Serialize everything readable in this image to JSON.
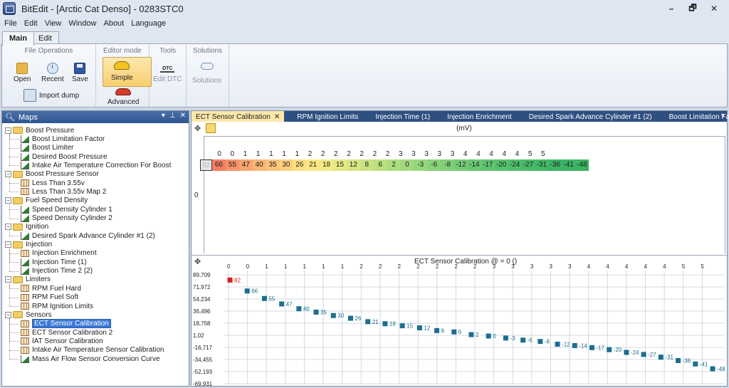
{
  "window": {
    "title": "BitEdit - [Arctic Cat Denso] - 0283STC0",
    "controls": [
      "–",
      "🗗",
      "✕"
    ]
  },
  "menu": [
    "File",
    "Edit",
    "View",
    "Window",
    "About",
    "Language"
  ],
  "ribbon": {
    "tabs": [
      "Main",
      "Edit"
    ],
    "groups": {
      "file_operations": {
        "title": "File Operations",
        "open": "Open",
        "recent": "Recent",
        "save": "Save",
        "import_dump": "Import dump"
      },
      "editor_mode": {
        "title": "Editor mode",
        "simple": "Simple",
        "advanced": "Advanced"
      },
      "tools": {
        "title": "Tools",
        "edit_dtc": "Edit DTC",
        "dtc_icon_text": "DTC"
      },
      "solutions": {
        "title": "Solutions",
        "solutions": "Solutions"
      }
    }
  },
  "maps_panel": {
    "title": "Maps",
    "header_buttons": [
      "▾",
      "⊥",
      "✕"
    ],
    "tree": [
      {
        "label": "Boost Pressure",
        "type": "folder"
      },
      {
        "label": "Boost Limitation Factor",
        "type": "curve"
      },
      {
        "label": "Boost Limiter",
        "type": "curve"
      },
      {
        "label": "Desired Boost Pressure",
        "type": "curve"
      },
      {
        "label": "Intake Air Temperature Correction For Boost",
        "type": "curve"
      },
      {
        "label": "Boost Pressure Sensor",
        "type": "folder"
      },
      {
        "label": "Less Than 3.55v",
        "type": "grid"
      },
      {
        "label": "Less Than 3.55v Map 2",
        "type": "grid"
      },
      {
        "label": "Fuel Speed Density",
        "type": "folder"
      },
      {
        "label": "Speed Density Cylinder 1",
        "type": "curve"
      },
      {
        "label": "Speed Density Cylinder 2",
        "type": "curve"
      },
      {
        "label": "Ignition",
        "type": "folder"
      },
      {
        "label": "Desired Spark Advance Cylinder #1 (2)",
        "type": "curve"
      },
      {
        "label": "Injection",
        "type": "folder"
      },
      {
        "label": "Injection Enrichment",
        "type": "grid"
      },
      {
        "label": "Injection Time (1)",
        "type": "curve"
      },
      {
        "label": "Injection Time 2 (2)",
        "type": "curve"
      },
      {
        "label": "Limiters",
        "type": "folder"
      },
      {
        "label": "RPM Fuel Hard",
        "type": "grid"
      },
      {
        "label": "RPM Fuel Soft",
        "type": "grid"
      },
      {
        "label": "RPM Ignition Limits",
        "type": "grid"
      },
      {
        "label": "Sensors",
        "type": "folder"
      },
      {
        "label": "ECT Sensor Calibration",
        "type": "grid",
        "selected": true
      },
      {
        "label": "ECT Sensor Calibration 2",
        "type": "grid"
      },
      {
        "label": "IAT Sensor Calibration",
        "type": "grid"
      },
      {
        "label": "Intake Air Temperature Sensor Calibration",
        "type": "grid"
      },
      {
        "label": "Mass Air Flow Sensor Conversion Curve",
        "type": "curve"
      }
    ]
  },
  "doc_tabs": [
    {
      "label": "ECT Sensor Calibration",
      "active": true
    },
    {
      "label": "RPM Ignition Limits"
    },
    {
      "label": "Injection Time (1)"
    },
    {
      "label": "Injection Enrichment"
    },
    {
      "label": "Desired Spark Advance Cylinder #1 (2)"
    },
    {
      "label": "Boost Limitation Factor"
    }
  ],
  "table": {
    "unit_label": "(mV)",
    "row_axis_label": "0",
    "row_label": "0",
    "headers": [
      "0",
      "0",
      "1",
      "1",
      "1",
      "1",
      "1",
      "2",
      "2",
      "2",
      "2",
      "2",
      "2",
      "2",
      "3",
      "3",
      "3",
      "3",
      "3",
      "4",
      "4",
      "4",
      "4",
      "4",
      "5",
      "5"
    ],
    "values": [
      "82",
      "66",
      "55",
      "47",
      "40",
      "35",
      "30",
      "26",
      "21",
      "18",
      "15",
      "12",
      "8",
      "6",
      "2",
      "0",
      "-3",
      "-6",
      "-8",
      "-12",
      "-14",
      "-17",
      "-20",
      "-24",
      "-27",
      "-31",
      "-36",
      "-41",
      "-48"
    ],
    "header_row": [
      "0",
      "0",
      "1",
      "1",
      "1",
      "1",
      "1",
      "2",
      "2",
      "2",
      "2",
      "2",
      "2",
      "2",
      "3",
      "3",
      "3",
      "3",
      "3",
      "4",
      "4",
      "4",
      "4",
      "4",
      "5",
      "5"
    ]
  },
  "chart_data": {
    "type": "line",
    "title": "ECT Sensor Calibration @  = 0 ()",
    "x_tick_labels": [
      "0",
      "0",
      "1",
      "1",
      "1",
      "1",
      "1",
      "2",
      "2",
      "2",
      "2",
      "2",
      "2",
      "2",
      "3",
      "3",
      "3",
      "3",
      "3",
      "4",
      "4",
      "4",
      "4",
      "4",
      "5",
      "5"
    ],
    "y_tick_labels": [
      "89,709",
      "71,972",
      "54,234",
      "36,496",
      "18,758",
      "1,02",
      "-16,717",
      "-34,455",
      "-52,193",
      "-69,931"
    ],
    "ylim": [
      -69.931,
      89.709
    ],
    "series": [
      {
        "values": [
          82,
          66,
          55,
          47,
          40,
          35,
          30,
          26,
          21,
          18,
          15,
          12,
          8,
          6,
          2,
          0,
          -3,
          -6,
          -8,
          -12,
          -14,
          -17,
          -20,
          -24,
          -27,
          -31,
          -36,
          -41,
          -48
        ]
      }
    ],
    "grid": true,
    "colors": {
      "marker": "#1b6f8f",
      "first_marker": "#e01b1b",
      "label": "#1b6f8f"
    }
  },
  "cell_colors": [
    "#ffffff",
    "#f47f63",
    "#f79369",
    "#f9a56f",
    "#fbb575",
    "#fcc37a",
    "#fdd07f",
    "#fde083",
    "#fbe886",
    "#f2ea87",
    "#e4e886",
    "#d7e585",
    "#c8e283",
    "#bbdf81",
    "#addc7f",
    "#a2d97d",
    "#96d67b",
    "#8ad279",
    "#7fcf77",
    "#74cb74",
    "#69c772",
    "#60c46f",
    "#57c16d",
    "#4ebe6b",
    "#49bb69",
    "#43b867",
    "#3db565",
    "#3cb464",
    "#3ab362"
  ]
}
